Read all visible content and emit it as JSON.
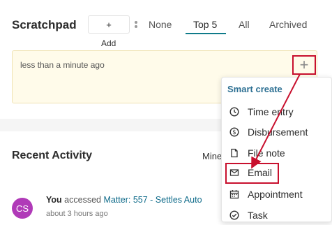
{
  "scratchpad": {
    "title": "Scratchpad",
    "add_button": "+",
    "add_label": "Add",
    "tabs": [
      "None",
      "Top 5",
      "All",
      "Archived"
    ],
    "active_tab": "Top 5",
    "note_text": "less than a minute ago",
    "plus_button": "+"
  },
  "smart_create": {
    "title": "Smart create",
    "items": [
      {
        "label": "Time entry",
        "icon": "clock-icon"
      },
      {
        "label": "Disbursement",
        "icon": "dollar-icon"
      },
      {
        "label": "File note",
        "icon": "file-icon"
      },
      {
        "label": "Email",
        "icon": "envelope-icon"
      },
      {
        "label": "Appointment",
        "icon": "calendar-icon"
      },
      {
        "label": "Task",
        "icon": "check-circle-icon"
      }
    ]
  },
  "recent_activity": {
    "title": "Recent Activity",
    "filter_label": "Mine",
    "items": [
      {
        "avatar_initials": "CS",
        "user": "You",
        "verb": "accessed",
        "link_text": "Matter: 557 - Settles Auto",
        "time": "about 3 hours ago"
      }
    ]
  },
  "colors": {
    "accent": "#0f7b8a",
    "highlight_red": "#c8102e",
    "note_bg": "#fffbea",
    "avatar_bg": "#b03ab8",
    "link": "#2c6f92"
  }
}
